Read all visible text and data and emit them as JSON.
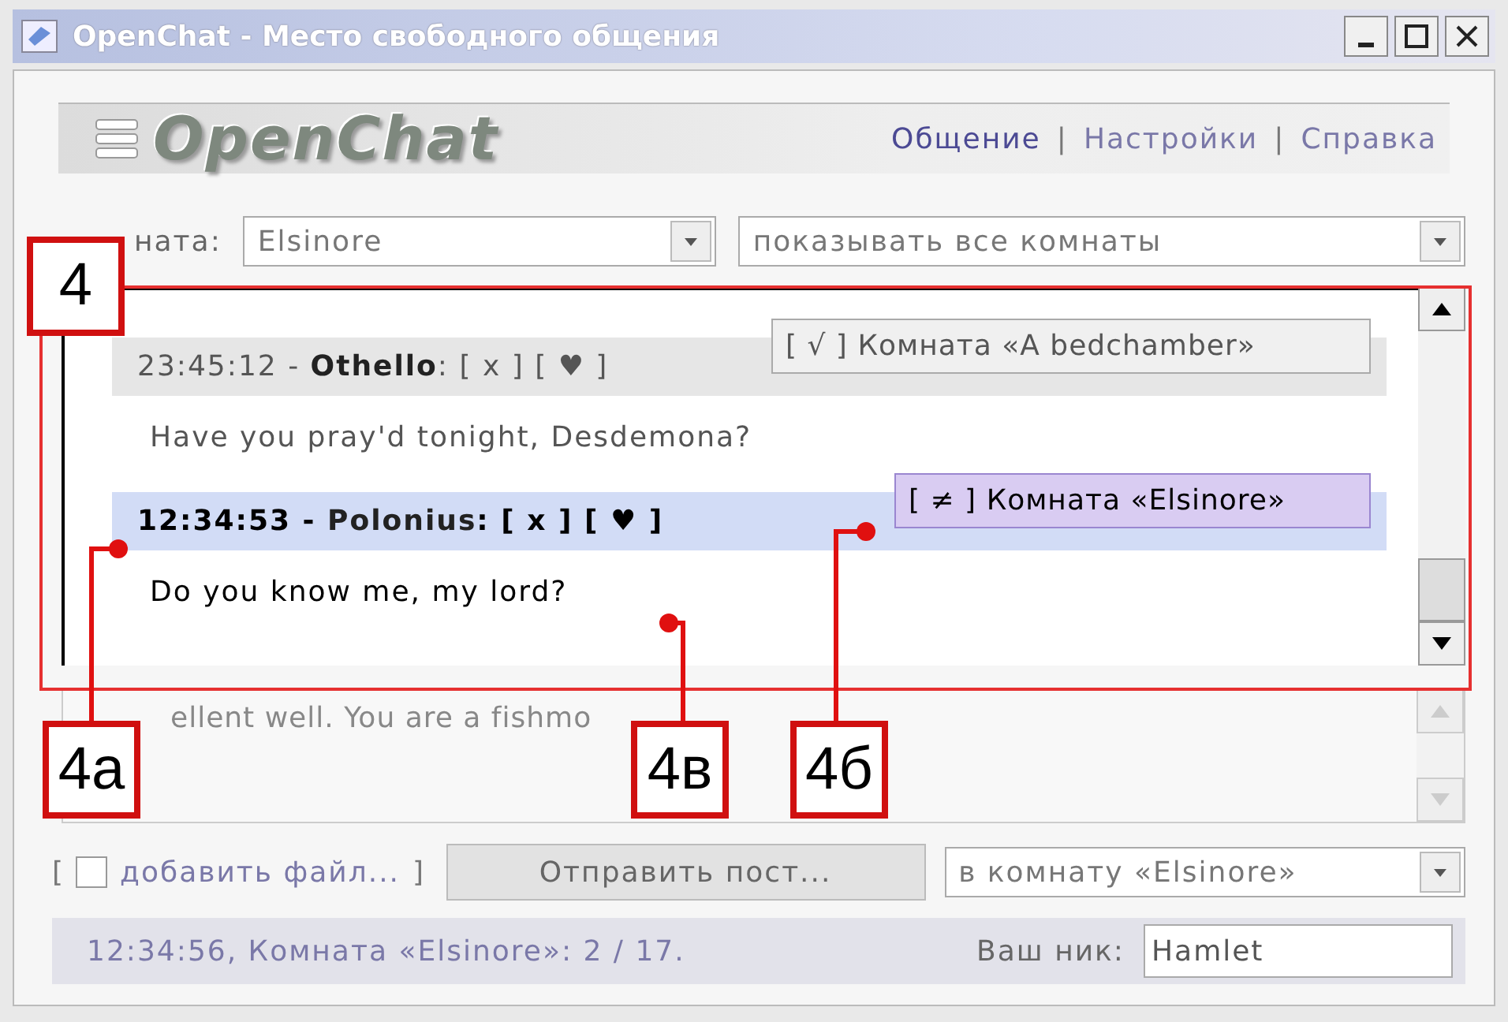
{
  "window": {
    "title": "OpenChat - Место свободного общения"
  },
  "logo": "OpenChat",
  "nav": [
    {
      "label": "Общение",
      "selected": true
    },
    {
      "label": "Настройки",
      "selected": false
    },
    {
      "label": "Справка",
      "selected": false
    }
  ],
  "nav_separators": [
    "|",
    "|"
  ],
  "room_label": "ната:",
  "room_select": "Elsinore",
  "filter_select": "показывать все комнаты",
  "messages": [
    {
      "header": "23:45:12 - **Othello**: [ x ] [ ♥ ]",
      "text": "Have you pray'd tonight, Desdemona?",
      "selected": false,
      "room_tag": {
        "mark": "[ √ ]",
        "label": "Комната «A bedchamber»",
        "current_room": false
      }
    },
    {
      "header": "12:34:53 - **Polonius**: [ x ] [ ♥ ]",
      "text": "Do you know me, my lord?",
      "selected": true,
      "room_tag": {
        "mark": "[ ≠ ]",
        "label": "Комната «Elsinore»",
        "current_room": true
      }
    }
  ],
  "input": {
    "value": "ellent well. You are a fishmo"
  },
  "attach": {
    "open": "[",
    "label": "добавить файл...",
    "close": "]",
    "checked": false
  },
  "send_button": "Отправить пост...",
  "target_select": "в комнату «Elsinore»",
  "status": "12:34:56, Комната «Elsinore»: 2 / 17.",
  "nick": {
    "label": "Ваш ник:",
    "value": "Hamlet"
  },
  "callouts": [
    {
      "label": "4"
    },
    {
      "label": "4а"
    },
    {
      "label": "4в"
    },
    {
      "label": "4б"
    }
  ]
}
